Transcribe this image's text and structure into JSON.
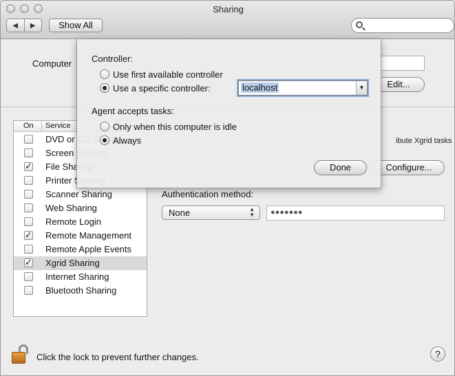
{
  "window": {
    "title": "Sharing",
    "back_icon": "◀",
    "forward_icon": "▶",
    "show_all_label": "Show All",
    "search": {
      "placeholder": ""
    }
  },
  "computer_name": {
    "label": "Computer",
    "edit_label": "Edit..."
  },
  "service_list": {
    "header_on": "On",
    "header_service": "Service",
    "items": [
      {
        "label": "DVD or CD Sharing",
        "checked": false,
        "selected": false
      },
      {
        "label": "Screen Sharing",
        "checked": false,
        "selected": false
      },
      {
        "label": "File Sharing",
        "checked": true,
        "selected": false
      },
      {
        "label": "Printer Sharing",
        "checked": false,
        "selected": false
      },
      {
        "label": "Scanner Sharing",
        "checked": false,
        "selected": false
      },
      {
        "label": "Web Sharing",
        "checked": false,
        "selected": false
      },
      {
        "label": "Remote Login",
        "checked": false,
        "selected": false
      },
      {
        "label": "Remote Management",
        "checked": true,
        "selected": false
      },
      {
        "label": "Remote Apple Events",
        "checked": false,
        "selected": false
      },
      {
        "label": "Xgrid Sharing",
        "checked": true,
        "selected": true
      },
      {
        "label": "Internet Sharing",
        "checked": false,
        "selected": false
      },
      {
        "label": "Bluetooth Sharing",
        "checked": false,
        "selected": false
      }
    ]
  },
  "xgrid_panel": {
    "description_partial": "ibute Xgrid tasks",
    "configure_label": "Configure...",
    "auth_label": "Authentication method:",
    "auth_value": "None",
    "password_mask": "●●●●●●●"
  },
  "sheet": {
    "controller_label": "Controller:",
    "controller_options": [
      {
        "label": "Use first available controller",
        "selected": false
      },
      {
        "label": "Use a specific controller:",
        "selected": true
      }
    ],
    "controller_value": "localhost",
    "agent_label": "Agent accepts tasks:",
    "agent_options": [
      {
        "label": "Only when this computer is idle",
        "selected": false
      },
      {
        "label": "Always",
        "selected": true
      }
    ],
    "done_label": "Done"
  },
  "footer": {
    "lock_text": "Click the lock to prevent further changes.",
    "help_label": "?"
  },
  "colors": {
    "selection": "#b9cde9",
    "selected_row": "#d9d9d9",
    "lock": "#d98b2e"
  }
}
